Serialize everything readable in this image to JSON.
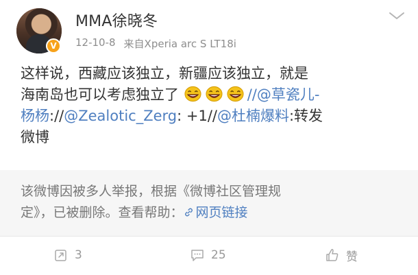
{
  "header": {
    "username": "MMA徐晓冬",
    "date": "12-10-8",
    "source": "来自Xperia arc S LT18i",
    "verified_badge": "V"
  },
  "post": {
    "line1": "这样说，西藏应该独立，新疆应该独立，就是",
    "line2_prefix": "海南岛也可以考虑独立了",
    "line2_separator": "//",
    "mention1": "@草瓷儿-",
    "mention1_cont": "杨杨",
    "line3_separator1": "://",
    "mention2": "@Zealotic_Zerg",
    "line3_middle": ": +1//",
    "mention3": "@杜楠爆料",
    "line3_end": ":转发",
    "line4": "微博"
  },
  "deleted": {
    "line1": "该微博因被多人举报，根据《微博社区管理规",
    "line2_prefix": "定》，已被删除。查看帮助：",
    "help_link": "网页链接"
  },
  "footer": {
    "repost_count": "3",
    "comment_count": "25",
    "like_label": "赞"
  },
  "colors": {
    "link": "#4f7fc0",
    "text": "#333333",
    "muted": "#8d8d8d",
    "deleted_bg": "#f6f6f6",
    "verified": "#f7a21b"
  },
  "icons": [
    "chevron-down-icon",
    "grin-emoji-icon",
    "link-icon",
    "repost-icon",
    "comment-icon",
    "thumbs-up-icon"
  ]
}
